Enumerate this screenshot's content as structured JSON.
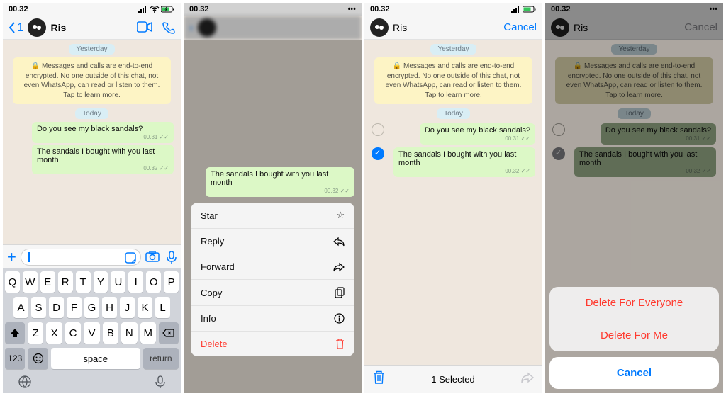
{
  "status": {
    "time": "00.32"
  },
  "contact": {
    "name": "Ris",
    "unread_count": "1"
  },
  "header_actions": {
    "cancel": "Cancel"
  },
  "dates": {
    "yesterday": "Yesterday",
    "today": "Today"
  },
  "encryption": "🔒 Messages and calls are end-to-end encrypted. No one outside of this chat, not even WhatsApp, can read or listen to them. Tap to learn more.",
  "messages": [
    {
      "text": "Do you see my black sandals?",
      "time": "00.31 ✓✓"
    },
    {
      "text": "The sandals I bought with you last month",
      "time": "00.32 ✓✓"
    }
  ],
  "keyboard": {
    "row1": [
      "Q",
      "W",
      "E",
      "R",
      "T",
      "Y",
      "U",
      "I",
      "O",
      "P"
    ],
    "row2": [
      "A",
      "S",
      "D",
      "F",
      "G",
      "H",
      "J",
      "K",
      "L"
    ],
    "row3": [
      "Z",
      "X",
      "C",
      "V",
      "B",
      "N",
      "M"
    ],
    "space": "space",
    "return": "return",
    "num": "123"
  },
  "context_menu": {
    "star": "Star",
    "reply": "Reply",
    "forward": "Forward",
    "copy": "Copy",
    "info": "Info",
    "delete": "Delete"
  },
  "selection": {
    "count_label": "1 Selected"
  },
  "action_sheet": {
    "delete_everyone": "Delete For Everyone",
    "delete_me": "Delete For Me",
    "cancel": "Cancel"
  }
}
